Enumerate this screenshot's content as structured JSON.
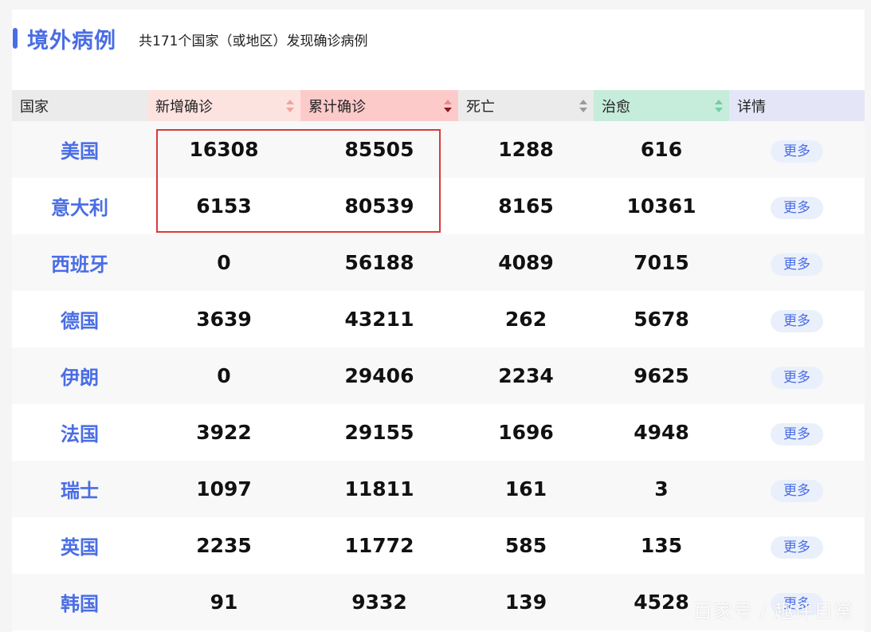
{
  "header": {
    "title": "境外病例",
    "subtitle": "共171个国家（或地区）发现确诊病例"
  },
  "columns": [
    {
      "label": "国家",
      "bg": "#ebebeb",
      "sortable": false
    },
    {
      "label": "新增确诊",
      "bg": "#fde3df",
      "sortable": true,
      "sort_color": "#f0a59a"
    },
    {
      "label": "累计确诊",
      "bg": "#fdcaca",
      "sortable": true,
      "sort_color": "#c0392b"
    },
    {
      "label": "死亡",
      "bg": "#ebebeb",
      "sortable": true,
      "sort_color": "#9a9a9a"
    },
    {
      "label": "治愈",
      "bg": "#c6ecdc",
      "sortable": true,
      "sort_color": "#6fcfa5"
    },
    {
      "label": "详情",
      "bg": "#e4e6f8",
      "sortable": false
    }
  ],
  "rows": [
    {
      "country": "美国",
      "new": "16308",
      "total": "85505",
      "deaths": "1288",
      "cured": "616",
      "more": "更多"
    },
    {
      "country": "意大利",
      "new": "6153",
      "total": "80539",
      "deaths": "8165",
      "cured": "10361",
      "more": "更多"
    },
    {
      "country": "西班牙",
      "new": "0",
      "total": "56188",
      "deaths": "4089",
      "cured": "7015",
      "more": "更多"
    },
    {
      "country": "德国",
      "new": "3639",
      "total": "43211",
      "deaths": "262",
      "cured": "5678",
      "more": "更多"
    },
    {
      "country": "伊朗",
      "new": "0",
      "total": "29406",
      "deaths": "2234",
      "cured": "9625",
      "more": "更多"
    },
    {
      "country": "法国",
      "new": "3922",
      "total": "29155",
      "deaths": "1696",
      "cured": "4948",
      "more": "更多"
    },
    {
      "country": "瑞士",
      "new": "1097",
      "total": "11811",
      "deaths": "161",
      "cured": "3",
      "more": "更多"
    },
    {
      "country": "英国",
      "new": "2235",
      "total": "11772",
      "deaths": "585",
      "cured": "135",
      "more": "更多"
    },
    {
      "country": "韩国",
      "new": "91",
      "total": "9332",
      "deaths": "139",
      "cured": "4528",
      "more": "更多"
    }
  ],
  "watermark": "百家号 / 趣评日常",
  "colors": {
    "accent": "#4a6de5",
    "highlight_border": "#d93a3a"
  }
}
